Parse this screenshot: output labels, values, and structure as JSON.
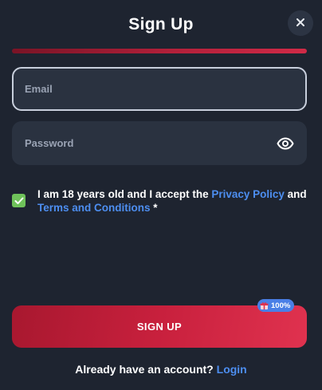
{
  "modal": {
    "title": "Sign Up",
    "close_icon": "close-icon",
    "progress_percent": 100
  },
  "form": {
    "email": {
      "placeholder": "Email",
      "value": ""
    },
    "password": {
      "placeholder": "Password",
      "value": "",
      "toggle_icon": "eye-icon"
    },
    "terms": {
      "checked": true,
      "text_before": "I am 18 years old and I accept the ",
      "privacy_link": "Privacy Policy",
      "text_middle": " and ",
      "terms_link": "Terms and Conditions",
      "required_mark": " *"
    },
    "submit_label": "SIGN UP",
    "bonus_badge": {
      "icon": "gift-icon",
      "label": "100%"
    }
  },
  "footer": {
    "prompt": "Already have an account?",
    "login_link": "Login"
  },
  "colors": {
    "background": "#1e2430",
    "field": "#2a3240",
    "accent_red": "#c8203d",
    "link_blue": "#4d8ef0",
    "checkbox_green": "#6fc25a",
    "badge_blue": "#4a7fe6"
  }
}
